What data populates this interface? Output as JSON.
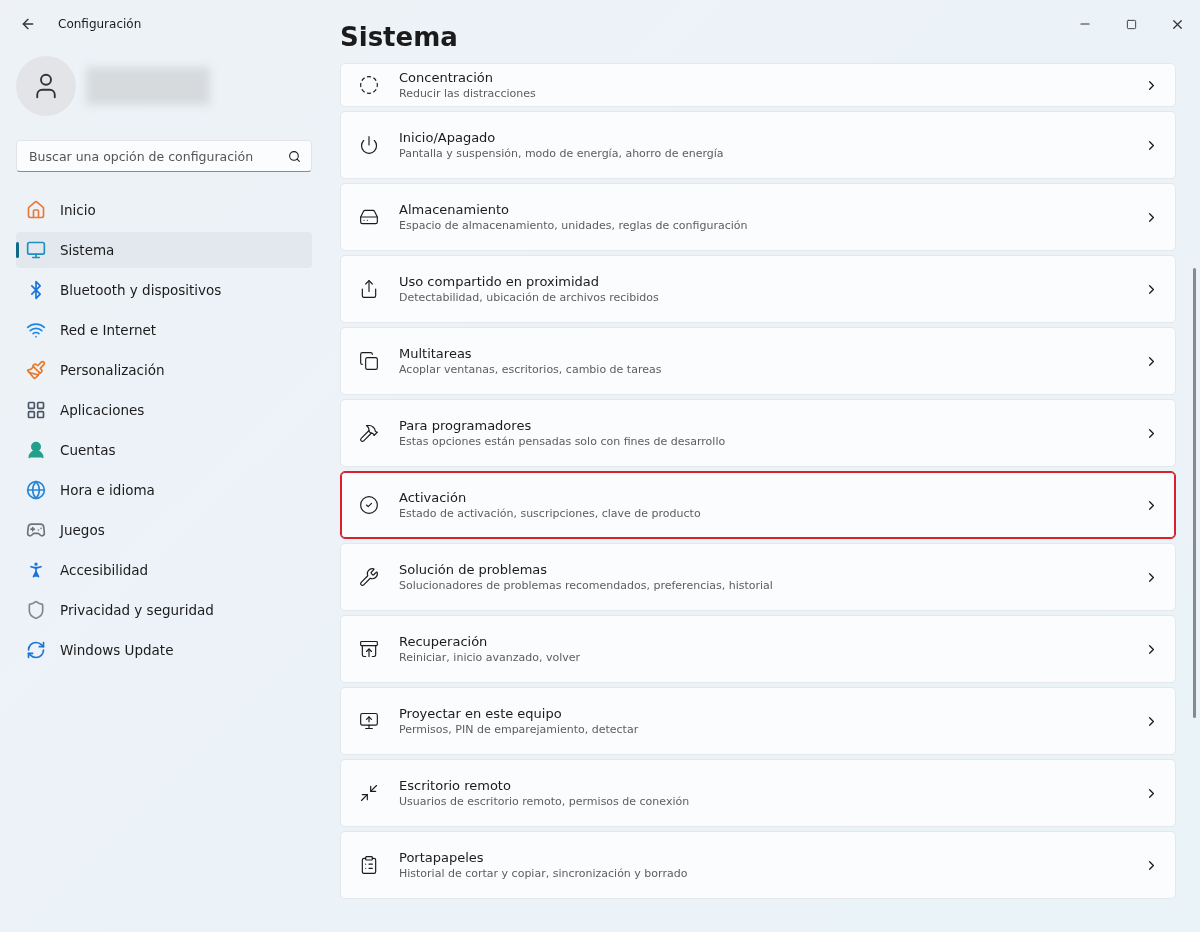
{
  "window": {
    "title": "Configuración"
  },
  "search": {
    "placeholder": "Buscar una opción de configuración"
  },
  "sidebar": {
    "items": [
      {
        "label": "Inicio",
        "selected": false
      },
      {
        "label": "Sistema",
        "selected": true
      },
      {
        "label": "Bluetooth y dispositivos",
        "selected": false
      },
      {
        "label": "Red e Internet",
        "selected": false
      },
      {
        "label": "Personalización",
        "selected": false
      },
      {
        "label": "Aplicaciones",
        "selected": false
      },
      {
        "label": "Cuentas",
        "selected": false
      },
      {
        "label": "Hora e idioma",
        "selected": false
      },
      {
        "label": "Juegos",
        "selected": false
      },
      {
        "label": "Accesibilidad",
        "selected": false
      },
      {
        "label": "Privacidad y seguridad",
        "selected": false
      },
      {
        "label": "Windows Update",
        "selected": false
      }
    ]
  },
  "page": {
    "title": "Sistema"
  },
  "settings": [
    {
      "title": "Concentración",
      "subtitle": "Reducir las distracciones",
      "highlighted": false
    },
    {
      "title": "Inicio/Apagado",
      "subtitle": "Pantalla y suspensión, modo de energía, ahorro de energía",
      "highlighted": false
    },
    {
      "title": "Almacenamiento",
      "subtitle": "Espacio de almacenamiento, unidades, reglas de configuración",
      "highlighted": false
    },
    {
      "title": "Uso compartido en proximidad",
      "subtitle": "Detectabilidad, ubicación de archivos recibidos",
      "highlighted": false
    },
    {
      "title": "Multitareas",
      "subtitle": "Acoplar ventanas, escritorios, cambio de tareas",
      "highlighted": false
    },
    {
      "title": "Para programadores",
      "subtitle": "Estas opciones están pensadas solo con fines de desarrollo",
      "highlighted": false
    },
    {
      "title": "Activación",
      "subtitle": "Estado de activación, suscripciones, clave de producto",
      "highlighted": true
    },
    {
      "title": "Solución de problemas",
      "subtitle": "Solucionadores de problemas recomendados, preferencias, historial",
      "highlighted": false
    },
    {
      "title": "Recuperación",
      "subtitle": "Reiniciar, inicio avanzado, volver",
      "highlighted": false
    },
    {
      "title": "Proyectar en este equipo",
      "subtitle": "Permisos, PIN de emparejamiento, detectar",
      "highlighted": false
    },
    {
      "title": "Escritorio remoto",
      "subtitle": "Usuarios de escritorio remoto, permisos de conexión",
      "highlighted": false
    },
    {
      "title": "Portapapeles",
      "subtitle": "Historial de cortar y copiar, sincronización y borrado",
      "highlighted": false
    }
  ]
}
